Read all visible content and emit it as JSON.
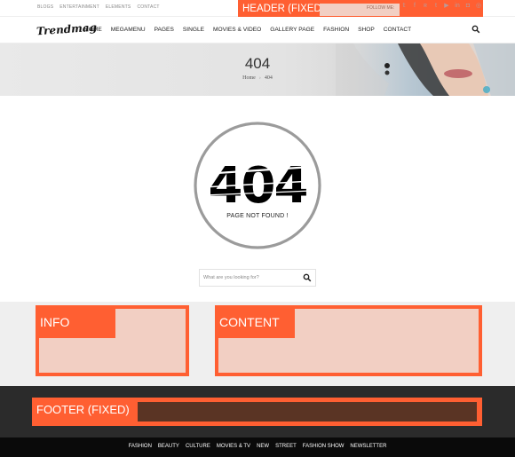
{
  "topbar": {
    "links": [
      "BLOGS",
      "ENTERTAINMENT",
      "ELEMENTS",
      "CONTACT"
    ],
    "follow_label": "FOLLOW ME:",
    "social_icons": [
      "twitter-icon",
      "facebook-icon",
      "rss-icon",
      "tumblr-icon",
      "youtube-icon",
      "linkedin-icon",
      "instagram-icon",
      "dribbble-icon"
    ]
  },
  "header_overlay": {
    "label": "HEADER (FIXED)"
  },
  "navbar": {
    "logo": "Trendmag",
    "items": [
      "HOME",
      "MEGAMENU",
      "PAGES",
      "SINGLE",
      "MOVIES & VIDEO",
      "GALLERY PAGE",
      "FASHION",
      "SHOP",
      "CONTACT"
    ],
    "search_icon": "search-icon"
  },
  "banner": {
    "title": "404",
    "breadcrumb": [
      "Home",
      "404"
    ]
  },
  "error": {
    "code": "404",
    "message": "PAGE NOT FOUND !"
  },
  "search": {
    "placeholder": "What are you looking for?"
  },
  "sections": {
    "info_label": "INFO",
    "content_label": "CONTENT"
  },
  "footer_overlay": {
    "label": "FOOTER (FIXED)"
  },
  "bottom_nav": [
    "FASHION",
    "BEAUTY",
    "CULTURE",
    "MOVIES & TV",
    "NEW",
    "STREET",
    "FASHION SHOW",
    "NEWSLETTER"
  ],
  "colors": {
    "accent": "#ff5f32",
    "overlay_fill": "#f2cfc3",
    "footer_bg": "#2b2b2b",
    "bottom_bar": "#0a0a0a"
  }
}
